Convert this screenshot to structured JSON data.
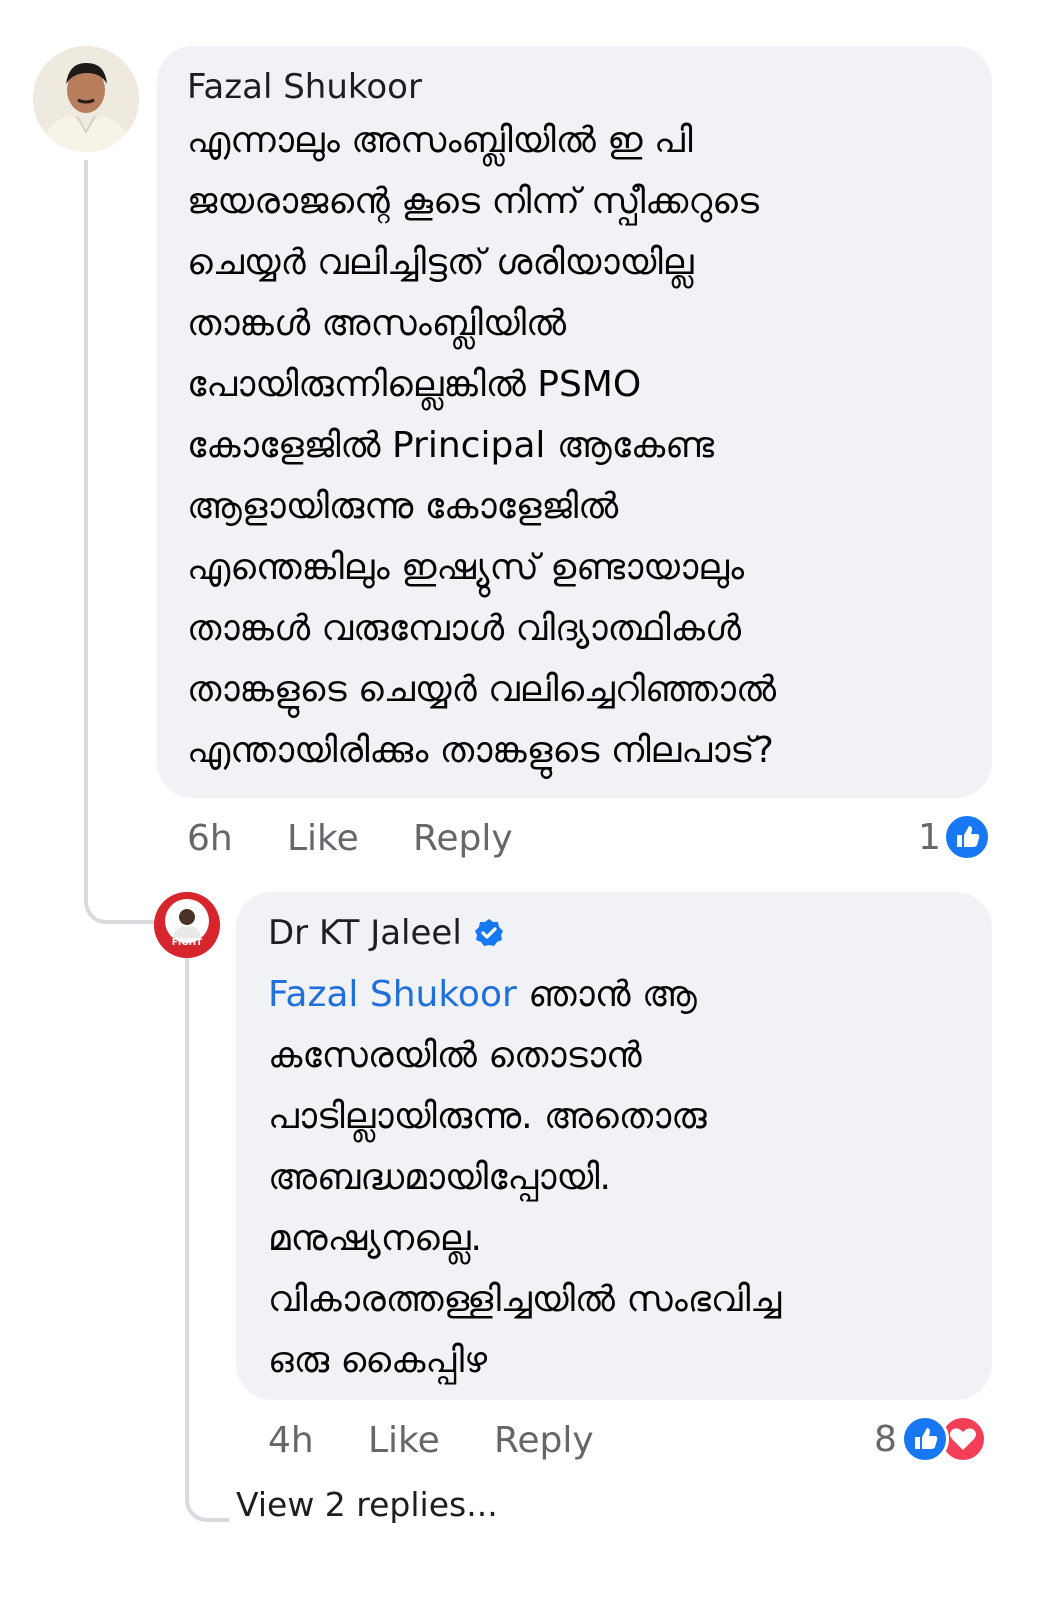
{
  "comment": {
    "author": "Fazal Shukoor",
    "lines": [
      "എന്നാലും അസംബ്ലിയിൽ ഇ പി",
      "ജയരാജന്റെ കൂടെ നിന്ന് സ്പീക്കറുടെ",
      "ചെയ്യർ വലിച്ചിട്ടത് ശരിയായില്ല",
      "താങ്കൾ അസംബ്ലിയിൽ",
      "പോയിരുന്നില്ലെങ്കിൽ PSMO",
      "കോളേജിൽ Principal ആകേണ്ട",
      "ആളായിരുന്നു കോളേജിൽ",
      "എന്തെങ്കിലും ഇഷ്യുസ് ഉണ്ടായാലും",
      "താങ്കൾ വരുമ്പോൾ വിദ്യാത്ഥികൾ",
      "താങ്കളുടെ ചെയ്യർ വലിച്ചെറിഞ്ഞാൽ",
      "എന്തായിരിക്കും താങ്കളുടെ നിലപാട്?"
    ],
    "time": "6h",
    "like_label": "Like",
    "reply_label": "Reply",
    "reaction_count": "1",
    "reaction_icons": [
      "like-icon"
    ]
  },
  "reply": {
    "author": "Dr KT Jaleel",
    "verified_icon": "verified-badge-icon",
    "mention": "Fazal Shukoor",
    "first_line_rest": " ഞാൻ ആ",
    "lines": [
      "കസേരയിൽ തൊടാൻ",
      "പാടില്ലായിരുന്നു. അതൊരു",
      "അബദ്ധമായിപ്പോയി.",
      "മനുഷ്യനല്ലെ.",
      "വികാരത്തള്ളിച്ചയിൽ സംഭവിച്ച",
      "ഒരു കൈപ്പിഴ"
    ],
    "time": "4h",
    "like_label": "Like",
    "reply_label": "Reply",
    "reaction_count": "8",
    "reaction_icons": [
      "like-icon",
      "love-icon"
    ],
    "avatar_text": "FIGHT"
  },
  "view_replies": "View 2 replies...",
  "colors": {
    "bubble": "#f0f2f5",
    "mention": "#216fdb",
    "meta": "#65676b",
    "like": "#1877f2",
    "love": "#f33e58"
  }
}
